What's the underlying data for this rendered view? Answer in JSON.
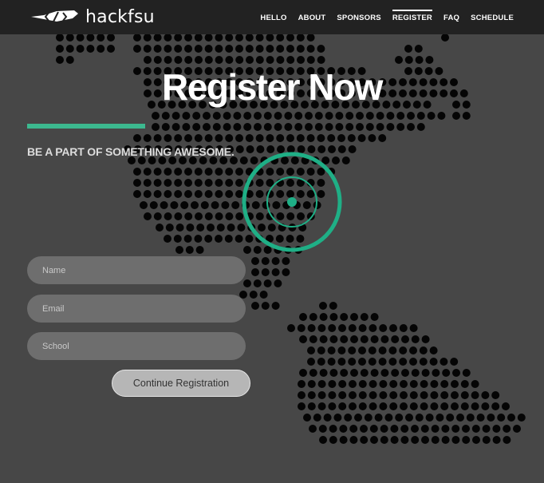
{
  "brand": {
    "name": "hackfsu"
  },
  "nav": [
    {
      "label": "HELLO"
    },
    {
      "label": "ABOUT"
    },
    {
      "label": "SPONSORS"
    },
    {
      "label": "REGISTER",
      "active": true
    },
    {
      "label": "FAQ"
    },
    {
      "label": "SCHEDULE"
    }
  ],
  "hero": {
    "title": "Register Now",
    "tagline": "BE A PART OF SOMETHING AWESOME."
  },
  "form": {
    "name_placeholder": "Name",
    "email_placeholder": "Email",
    "school_placeholder": "School",
    "submit_label": "Continue Registration"
  },
  "colors": {
    "accent": "#3cb98f",
    "background": "#474747",
    "navbar": "#222222",
    "field": "#6e6e6e",
    "map_dot": "#050505"
  },
  "icons": {
    "logo_mark": "hackfsu-feather-logo-icon",
    "map": "dotted-world-map",
    "location": "location-target-icon"
  }
}
